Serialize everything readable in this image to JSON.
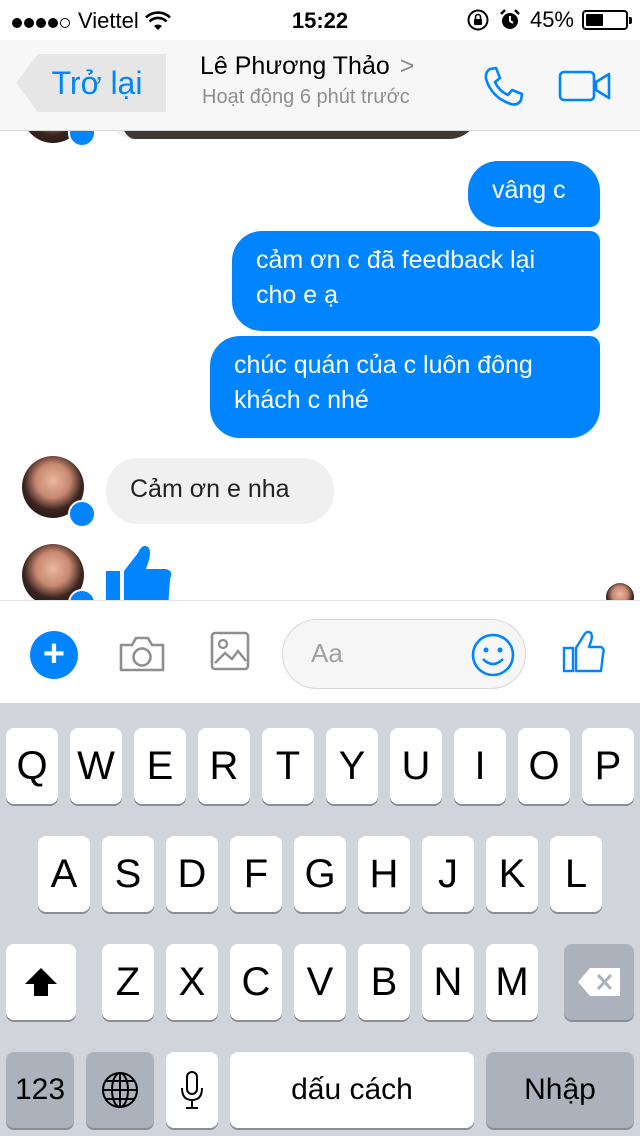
{
  "status_bar": {
    "carrier": "Viettel",
    "time": "15:22",
    "battery": "45%",
    "battery_level": 0.45
  },
  "nav": {
    "back_label": "Trở lại",
    "contact_name": "Lê Phương Thảo",
    "chevron": ">",
    "activity": "Hoạt động 6 phút trước",
    "call_icon": "phone-icon",
    "video_icon": "video-camera-icon"
  },
  "messages": [
    {
      "direction": "out",
      "text": "vâng c"
    },
    {
      "direction": "out",
      "text": "cảm ơn c đã feedback lại cho e ạ"
    },
    {
      "direction": "out",
      "text": "chúc quán của c luôn đông khách c nhé"
    },
    {
      "direction": "in",
      "text": "Cảm ơn e nha"
    },
    {
      "direction": "in",
      "type": "like",
      "icon": "thumbs-up-icon"
    }
  ],
  "composer": {
    "placeholder": "Aa",
    "icons": [
      "plus-icon",
      "camera-icon",
      "photo-icon",
      "emoji-icon",
      "thumbs-up-icon"
    ]
  },
  "keyboard": {
    "row1": [
      "Q",
      "W",
      "E",
      "R",
      "T",
      "Y",
      "U",
      "I",
      "O",
      "P"
    ],
    "row2": [
      "A",
      "S",
      "D",
      "F",
      "G",
      "H",
      "J",
      "K",
      "L"
    ],
    "row3": [
      "Z",
      "X",
      "C",
      "V",
      "B",
      "N",
      "M"
    ],
    "numbers_key": "123",
    "space_key": "dấu cách",
    "return_key": "Nhập"
  },
  "colors": {
    "accent": "#0084ff",
    "incoming_bubble": "#f0f0f0",
    "keyboard_bg": "#d1d5db"
  }
}
